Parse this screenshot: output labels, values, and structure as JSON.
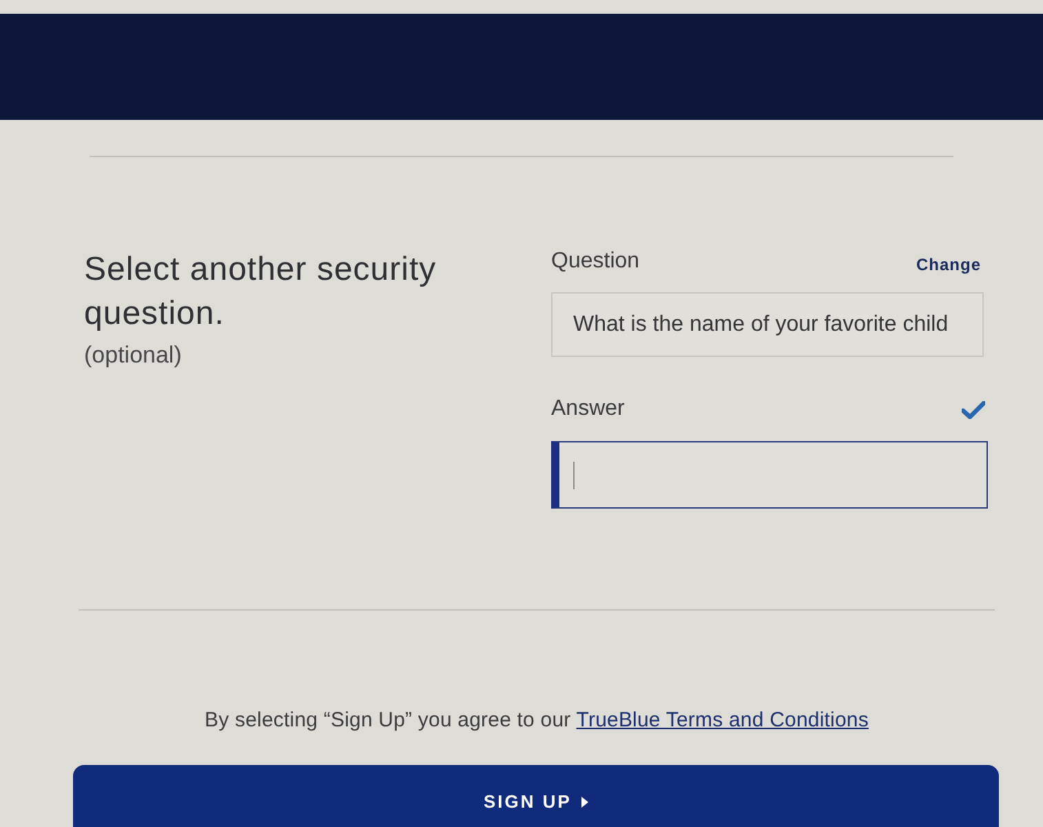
{
  "section": {
    "title": "Select another security question.",
    "note": "(optional)"
  },
  "question": {
    "label": "Question",
    "action": "Change",
    "value": "What is the name of your favorite child"
  },
  "answer": {
    "label": "Answer",
    "valid": true,
    "focused": true
  },
  "terms": {
    "text": "By selecting “Sign Up” you agree to our",
    "link": "TrueBlue Terms and Conditions"
  },
  "submit": {
    "label": "SIGN UP"
  }
}
